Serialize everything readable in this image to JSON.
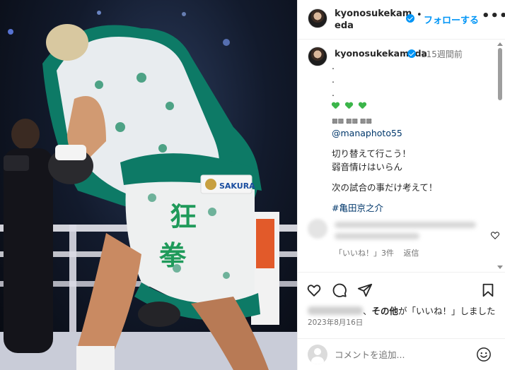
{
  "photo": {
    "alt_description": "boxer in paisley trunks",
    "trunks_text": "狂拳",
    "sponsor_label": "SAKURA"
  },
  "header": {
    "username": "kyonosukekameda",
    "separator": "•",
    "follow_label": "フォローする",
    "more_label": "•••"
  },
  "caption": {
    "username": "kyonosukekameda",
    "time_ago": "115週間前",
    "lines": [
      ".",
      ".",
      "."
    ],
    "boxes": "▩▩ ▩▩ ▩▩",
    "mention": "@manaphoto55",
    "text1": "切り替えて行こう！",
    "text2": "弱音情けはいらん",
    "text3": "次の試合の事だけ考えて！",
    "hashtag": "#亀田京之介"
  },
  "comment": {
    "likes": "「いいね！」3件",
    "reply": "返信"
  },
  "actions": {
    "likes_suffix_bold": "その他",
    "likes_suffix": "が「いいね！」しました",
    "likes_separator": "、",
    "date": "2023年8月16日"
  },
  "add_comment": {
    "placeholder": "コメントを追加..."
  },
  "colors": {
    "accent": "#0095f6",
    "link": "#00376b",
    "trunks_green": "#1f9a5a",
    "fur_teal": "#0d7a66"
  }
}
